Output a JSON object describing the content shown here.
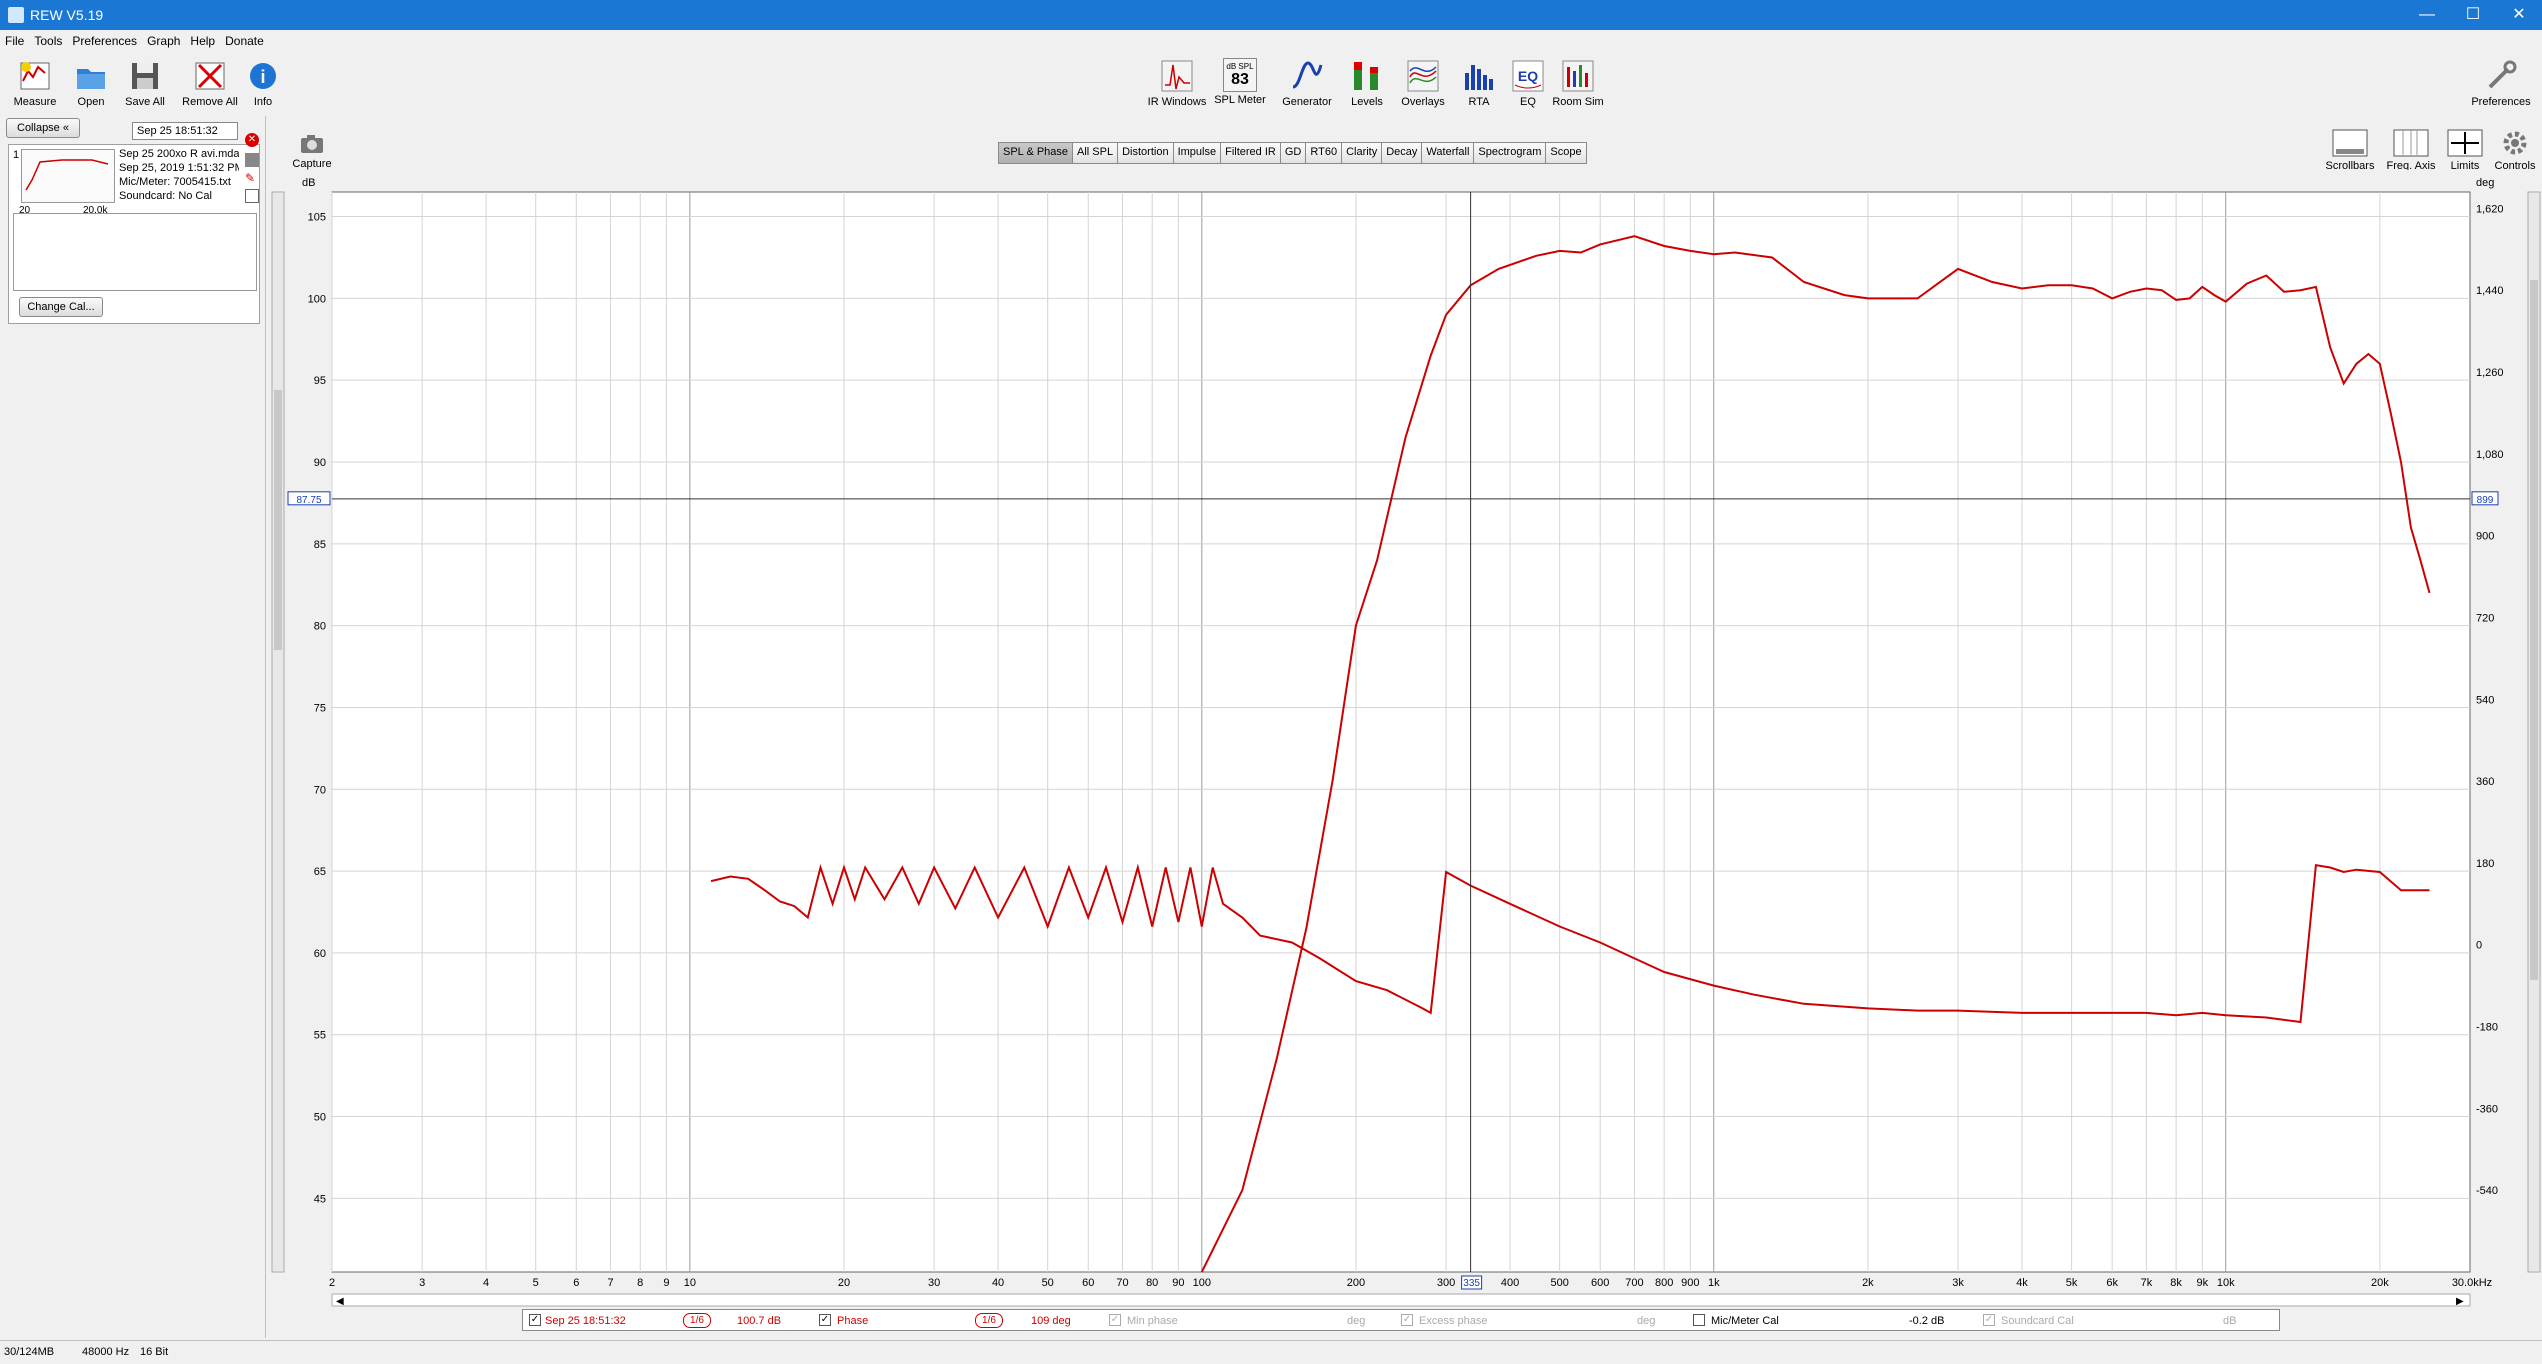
{
  "window": {
    "title": "REW V5.19",
    "minimize": "—",
    "maximize": "☐",
    "close": "✕"
  },
  "menu": [
    "File",
    "Tools",
    "Preferences",
    "Graph",
    "Help",
    "Donate"
  ],
  "toolbar_left": [
    {
      "label": "Measure",
      "icon": "measure-icon"
    },
    {
      "label": "Open",
      "icon": "open-folder-icon"
    },
    {
      "label": "Save All",
      "icon": "save-all-icon"
    },
    {
      "label": "Remove All",
      "icon": "remove-all-icon"
    },
    {
      "label": "Info",
      "icon": "info-icon"
    }
  ],
  "toolbar_center": [
    {
      "label": "IR Windows",
      "icon": "ir-windows-icon"
    },
    {
      "label": "SPL Meter",
      "icon": "spl-meter-icon",
      "badge_top": "dB SPL",
      "badge_value": "83"
    },
    {
      "label": "Generator",
      "icon": "generator-icon"
    },
    {
      "label": "Levels",
      "icon": "levels-icon"
    },
    {
      "label": "Overlays",
      "icon": "overlays-icon"
    },
    {
      "label": "RTA",
      "icon": "rta-icon"
    },
    {
      "label": "EQ",
      "icon": "eq-icon"
    },
    {
      "label": "Room Sim",
      "icon": "room-sim-icon"
    }
  ],
  "toolbar_right": {
    "label": "Preferences",
    "icon": "preferences-icon"
  },
  "panel": {
    "collapse": "Collapse",
    "time_field": "Sep 25 18:51:32",
    "measurement": {
      "index": "1",
      "line1": "Sep 25 200xo R avi.mdat",
      "line2": "Sep 25, 2019 1:51:32 PM",
      "line3": "Mic/Meter: 7005415.txt",
      "line4": "Soundcard: No Cal",
      "thumb_left": "20",
      "thumb_right": "20.0k"
    },
    "change_cal": "Change Cal..."
  },
  "capture": "Capture",
  "tabs": [
    "SPL & Phase",
    "All SPL",
    "Distortion",
    "Impulse",
    "Filtered IR",
    "GD",
    "RT60",
    "Clarity",
    "Decay",
    "Waterfall",
    "Spectrogram",
    "Scope"
  ],
  "active_tab": "SPL & Phase",
  "graph_controls": [
    {
      "label": "Scrollbars",
      "icon": "scrollbars-icon"
    },
    {
      "label": "Freq. Axis",
      "icon": "freq-axis-icon"
    },
    {
      "label": "Limits",
      "icon": "limits-icon"
    },
    {
      "label": "Controls",
      "icon": "controls-gear-icon"
    }
  ],
  "chart_data": {
    "type": "line",
    "xlabel": "",
    "x_scale": "log",
    "x_unit_label": "30.0kHz",
    "xlim": [
      2,
      30000
    ],
    "x_ticks": [
      {
        "v": 2,
        "t": "2"
      },
      {
        "v": 3,
        "t": "3"
      },
      {
        "v": 4,
        "t": "4"
      },
      {
        "v": 5,
        "t": "5"
      },
      {
        "v": 6,
        "t": "6"
      },
      {
        "v": 7,
        "t": "7"
      },
      {
        "v": 8,
        "t": "8"
      },
      {
        "v": 9,
        "t": "9"
      },
      {
        "v": 10,
        "t": "10"
      },
      {
        "v": 20,
        "t": "20"
      },
      {
        "v": 30,
        "t": "30"
      },
      {
        "v": 40,
        "t": "40"
      },
      {
        "v": 50,
        "t": "50"
      },
      {
        "v": 60,
        "t": "60"
      },
      {
        "v": 70,
        "t": "70"
      },
      {
        "v": 80,
        "t": "80"
      },
      {
        "v": 90,
        "t": "90"
      },
      {
        "v": 100,
        "t": "100"
      },
      {
        "v": 200,
        "t": "200"
      },
      {
        "v": 300,
        "t": "300"
      },
      {
        "v": 400,
        "t": "400"
      },
      {
        "v": 500,
        "t": "500"
      },
      {
        "v": 600,
        "t": "600"
      },
      {
        "v": 700,
        "t": "700"
      },
      {
        "v": 800,
        "t": "800"
      },
      {
        "v": 900,
        "t": "900"
      },
      {
        "v": 1000,
        "t": "1k"
      },
      {
        "v": 2000,
        "t": "2k"
      },
      {
        "v": 3000,
        "t": "3k"
      },
      {
        "v": 4000,
        "t": "4k"
      },
      {
        "v": 5000,
        "t": "5k"
      },
      {
        "v": 6000,
        "t": "6k"
      },
      {
        "v": 7000,
        "t": "7k"
      },
      {
        "v": 8000,
        "t": "8k"
      },
      {
        "v": 9000,
        "t": "9k"
      },
      {
        "v": 10000,
        "t": "10k"
      },
      {
        "v": 20000,
        "t": "20k"
      }
    ],
    "y_left_label": "dB",
    "ylim_left": [
      40.5,
      106.5
    ],
    "y_left_ticks": [
      105,
      100,
      95,
      90,
      85,
      80,
      75,
      70,
      65,
      60,
      55,
      50,
      45
    ],
    "y_right_label": "deg",
    "ylim_right": [
      -720,
      1656
    ],
    "y_right_ticks": [
      1620,
      1440,
      1260,
      1080,
      900,
      720,
      540,
      360,
      180,
      0,
      -180,
      -360,
      -540
    ],
    "cursor": {
      "x": 335,
      "x_label": "335",
      "y_left": 87.75,
      "y_left_label": "87.75",
      "y_right_label": "899"
    },
    "grid": true,
    "series": [
      {
        "name": "Sep 25 18:51:32",
        "color": "#cc0000",
        "axis": "left",
        "x": [
          100,
          120,
          140,
          160,
          180,
          200,
          220,
          250,
          280,
          300,
          335,
          380,
          450,
          500,
          550,
          600,
          700,
          800,
          900,
          1000,
          1100,
          1300,
          1500,
          1800,
          2000,
          2500,
          3000,
          3500,
          4000,
          4500,
          5000,
          5500,
          6000,
          6500,
          7000,
          7500,
          8000,
          8500,
          9000,
          9500,
          10000,
          11000,
          12000,
          13000,
          14000,
          15000,
          16000,
          17000,
          18000,
          19000,
          20000,
          21000,
          22000,
          23000,
          24000,
          25000
        ],
        "y": [
          39.0,
          45.5,
          53.5,
          61.5,
          70.5,
          80.0,
          84.0,
          91.5,
          96.5,
          99.0,
          100.8,
          101.8,
          102.6,
          102.9,
          102.8,
          103.3,
          103.8,
          103.2,
          102.9,
          102.7,
          102.8,
          102.5,
          101.0,
          100.2,
          100.0,
          100.0,
          101.8,
          101.0,
          100.6,
          100.8,
          100.8,
          100.6,
          100.0,
          100.4,
          100.6,
          100.5,
          99.9,
          100.0,
          100.7,
          100.2,
          99.8,
          100.9,
          101.4,
          100.4,
          100.5,
          100.7,
          97.0,
          94.8,
          96.0,
          96.6,
          96.0,
          93.0,
          90.0,
          86.0,
          84.0,
          82.0
        ],
        "data_labels_right": "100.7 dB"
      },
      {
        "name": "Phase",
        "color": "#cc0000",
        "axis": "right",
        "note": "wrapped phase in degrees",
        "x": [
          11,
          12,
          13,
          14,
          15,
          16,
          17,
          18,
          19,
          20,
          21,
          22,
          24,
          26,
          28,
          30,
          33,
          36,
          40,
          45,
          50,
          55,
          60,
          65,
          70,
          75,
          80,
          85,
          90,
          95,
          100,
          105,
          110,
          120,
          130,
          150,
          170,
          200,
          230,
          270,
          280,
          300,
          335,
          400,
          500,
          600,
          700,
          800,
          1000,
          1200,
          1500,
          2000,
          2500,
          3000,
          4000,
          5000,
          6000,
          7000,
          8000,
          9000,
          10000,
          12000,
          14000,
          15000,
          16000,
          17000,
          18000,
          20000,
          22000,
          25000
        ],
        "y": [
          140,
          150,
          145,
          120,
          95,
          85,
          60,
          170,
          90,
          170,
          100,
          170,
          100,
          170,
          90,
          170,
          80,
          170,
          60,
          170,
          40,
          170,
          60,
          170,
          50,
          170,
          40,
          170,
          50,
          170,
          40,
          170,
          90,
          60,
          20,
          5,
          -30,
          -80,
          -100,
          -140,
          -150,
          160,
          130,
          90,
          40,
          5,
          -30,
          -60,
          -90,
          -110,
          -130,
          -140,
          -145,
          -145,
          -150,
          -150,
          -150,
          -150,
          -155,
          -150,
          -155,
          -160,
          -170,
          175,
          170,
          160,
          165,
          160,
          120,
          120
        ],
        "data_labels_right": "109 deg"
      }
    ]
  },
  "legend": {
    "meas_name": "Sep 25 18:51:32",
    "smooth1": "1/6",
    "spl_value": "100.7 dB",
    "phase_label": "Phase",
    "smooth2": "1/6",
    "phase_value": "109 deg",
    "min_phase": "Min phase",
    "min_phase_unit": "deg",
    "excess_phase": "Excess phase",
    "excess_phase_unit": "deg",
    "mic_cal": "Mic/Meter Cal",
    "mic_cal_value": "-0.2 dB",
    "soundcard_cal": "Soundcard Cal",
    "soundcard_unit": "dB"
  },
  "status": {
    "memory": "30/124MB",
    "rate": "48000 Hz",
    "bits": "16 Bit"
  }
}
